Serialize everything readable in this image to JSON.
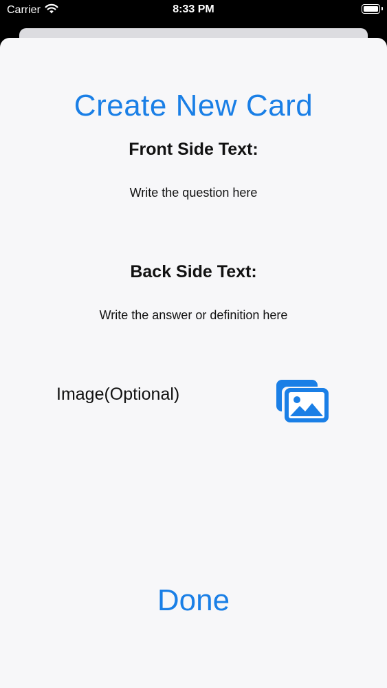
{
  "status_bar": {
    "carrier": "Carrier",
    "time": "8:33 PM",
    "wifi_icon": "wifi-icon",
    "battery_icon": "battery-icon"
  },
  "form": {
    "title": "Create New Card",
    "front_label": "Front Side Text:",
    "front_placeholder": "Write the question here",
    "back_label": "Back Side Text:",
    "back_placeholder": "Write the answer or definition here",
    "image_label": "Image(Optional)",
    "image_icon": "photo-gallery-icon",
    "done_label": "Done"
  },
  "colors": {
    "accent": "#1a7fe6",
    "sheet_background": "#f7f7f9",
    "status_bar_background": "#000000"
  }
}
